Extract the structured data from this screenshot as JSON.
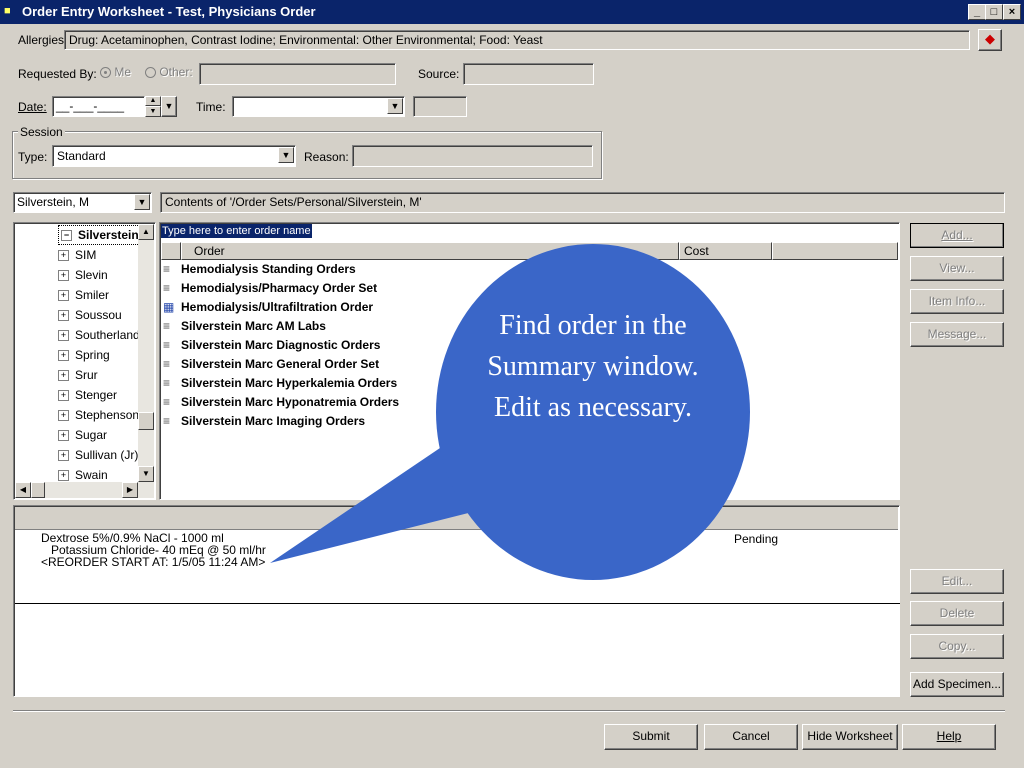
{
  "window": {
    "title": "Order Entry Worksheet - Test, Physicians Order",
    "minimize": "_",
    "maximize": "□",
    "close": "×"
  },
  "allergies": {
    "label": "Allergies:",
    "value": "Drug: Acetaminophen, Contrast Iodine; Environmental: Other Environmental; Food: Yeast"
  },
  "requested_by": {
    "label": "Requested By:",
    "me": "Me",
    "other": "Other:",
    "source_label": "Source:"
  },
  "date": {
    "label": "Date:",
    "value": "__-___-____",
    "time_label": "Time:"
  },
  "session": {
    "group_label": "Session",
    "type_label": "Type:",
    "type_value": "Standard",
    "reason_label": "Reason:"
  },
  "provider_select": {
    "value": "Silverstein, M"
  },
  "contents_path": "Contents of '/Order Sets/Personal/Silverstein, M'",
  "tree": {
    "selected": "Silverstein",
    "items": [
      "SIM",
      "Slevin",
      "Smiler",
      "Soussou",
      "Southerland",
      "Spring",
      "Srur",
      "Stenger",
      "Stephenson",
      "Sugar",
      "Sullivan (Jr)",
      "Swain"
    ]
  },
  "order_list": {
    "placeholder": "Type here to enter order name",
    "columns": [
      "Order",
      "Cost"
    ],
    "orders": [
      {
        "name": "Hemodialysis Standing Orders",
        "icon": "order-set-icon"
      },
      {
        "name": "Hemodialysis/Pharmacy Order Set",
        "icon": "order-set-icon"
      },
      {
        "name": "Hemodialysis/Ultrafiltration Order",
        "icon": "grid-icon"
      },
      {
        "name": "Silverstein Marc AM Labs",
        "icon": "order-set-icon"
      },
      {
        "name": "Silverstein Marc Diagnostic Orders",
        "icon": "order-set-icon"
      },
      {
        "name": "Silverstein Marc General Order Set",
        "icon": "order-set-icon"
      },
      {
        "name": "Silverstein Marc Hyperkalemia Orders",
        "icon": "order-set-icon"
      },
      {
        "name": "Silverstein Marc Hyponatremia Orders",
        "icon": "order-set-icon"
      },
      {
        "name": "Silverstein Marc Imaging Orders",
        "icon": "order-set-icon"
      }
    ]
  },
  "right_buttons": {
    "add": "Add...",
    "view": "View...",
    "item_info": "Item Info...",
    "message": "Message..."
  },
  "summary": {
    "line1": "Dextrose  5%/0.9% NaCl - 1000 ml",
    "line2": "Potassium Chloride- 40 mEq @ 50 ml/hr",
    "line3": "<REORDER START AT: 1/5/05 11:24 AM>",
    "status": "Pending"
  },
  "summary_buttons": {
    "edit": "Edit...",
    "delete": "Delete",
    "copy": "Copy...",
    "add_specimen": "Add Specimen..."
  },
  "bottom_buttons": {
    "submit": "Submit",
    "cancel": "Cancel",
    "hide_worksheet": "Hide Worksheet",
    "help": "Help"
  },
  "callout": {
    "text": "Find order in the Summary window. Edit as  necessary.",
    "color": "#3a66c8"
  }
}
